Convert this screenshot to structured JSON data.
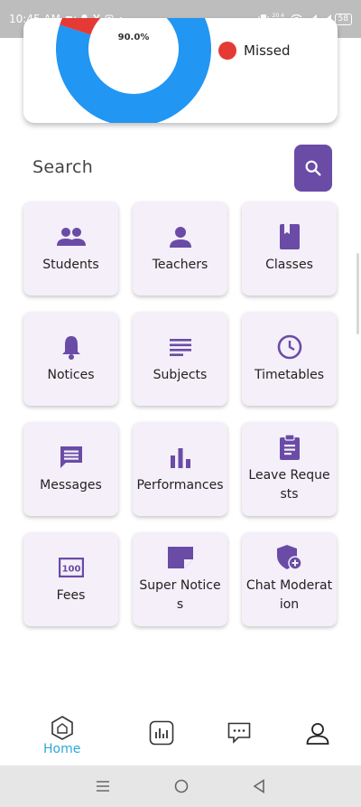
{
  "status_bar": {
    "time": "10:45 AM",
    "net_speed": "20.4 KB/S",
    "battery": "58"
  },
  "attendance_chart": {
    "percent_label": "90.0%",
    "legend_missed": "Missed"
  },
  "chart_data": {
    "type": "pie",
    "labels": [
      "",
      "Missed"
    ],
    "values": [
      90.0,
      10.0
    ],
    "colors": [
      "#2196f3",
      "#e53935"
    ]
  },
  "search": {
    "label": "Search",
    "icon": "search-icon"
  },
  "tiles": [
    {
      "label": "Students",
      "icon": "people-icon"
    },
    {
      "label": "Teachers",
      "icon": "person-icon"
    },
    {
      "label": "Classes",
      "icon": "book-icon"
    },
    {
      "label": "Notices",
      "icon": "bell-icon"
    },
    {
      "label": "Subjects",
      "icon": "subject-lines-icon"
    },
    {
      "label": "Timetables",
      "icon": "clock-icon"
    },
    {
      "label": "Messages",
      "icon": "message-icon"
    },
    {
      "label": "Performances",
      "icon": "bar-chart-icon"
    },
    {
      "label": "Leave Requests",
      "icon": "clipboard-icon"
    },
    {
      "label": "Fees",
      "icon": "fees-icon"
    },
    {
      "label": "Super Notices",
      "icon": "note-icon"
    },
    {
      "label": "Chat Moderation",
      "icon": "shield-add-icon"
    }
  ],
  "bottom_nav": {
    "home_label": "Home",
    "items": [
      "home-icon",
      "analytics-icon",
      "chat-icon",
      "profile-icon"
    ]
  },
  "colors": {
    "accent": "#6a4ba6",
    "tile_bg": "#f4eff8",
    "donut": "#2196f3",
    "missed": "#e53935",
    "nav_active": "#2aa8d8"
  }
}
